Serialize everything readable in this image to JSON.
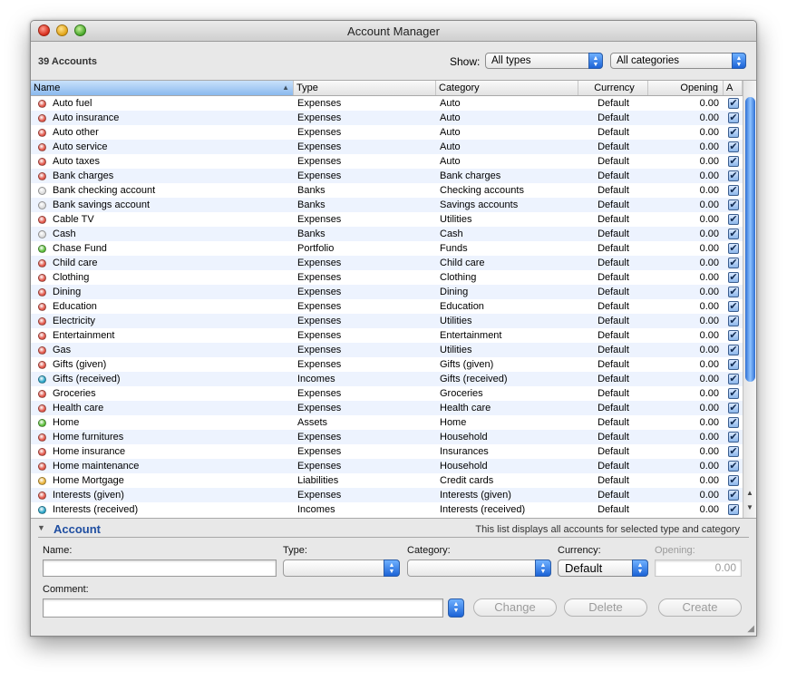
{
  "window": {
    "title": "Account Manager"
  },
  "toolbar": {
    "count_label": "39 Accounts",
    "show_label": "Show:",
    "type_filter": "All types",
    "category_filter": "All categories"
  },
  "table": {
    "columns": [
      "Name",
      "Type",
      "Category",
      "Currency",
      "Opening",
      "A"
    ],
    "sort_indicator": "▲",
    "rows": [
      {
        "name": "Auto fuel",
        "type": "Expenses",
        "category": "Auto",
        "currency": "Default",
        "opening": "0.00",
        "color": "#e2574a",
        "checked": true
      },
      {
        "name": "Auto insurance",
        "type": "Expenses",
        "category": "Auto",
        "currency": "Default",
        "opening": "0.00",
        "color": "#e2574a",
        "checked": true
      },
      {
        "name": "Auto other",
        "type": "Expenses",
        "category": "Auto",
        "currency": "Default",
        "opening": "0.00",
        "color": "#e2574a",
        "checked": true
      },
      {
        "name": "Auto service",
        "type": "Expenses",
        "category": "Auto",
        "currency": "Default",
        "opening": "0.00",
        "color": "#e2574a",
        "checked": true
      },
      {
        "name": "Auto taxes",
        "type": "Expenses",
        "category": "Auto",
        "currency": "Default",
        "opening": "0.00",
        "color": "#e2574a",
        "checked": true
      },
      {
        "name": "Bank charges",
        "type": "Expenses",
        "category": "Bank charges",
        "currency": "Default",
        "opening": "0.00",
        "color": "#e2574a",
        "checked": true
      },
      {
        "name": "Bank checking account",
        "type": "Banks",
        "category": "Checking accounts",
        "currency": "Default",
        "opening": "0.00",
        "color": "#dcdcdc",
        "checked": true
      },
      {
        "name": "Bank savings account",
        "type": "Banks",
        "category": "Savings accounts",
        "currency": "Default",
        "opening": "0.00",
        "color": "#dcdcdc",
        "checked": true
      },
      {
        "name": "Cable TV",
        "type": "Expenses",
        "category": "Utilities",
        "currency": "Default",
        "opening": "0.00",
        "color": "#e2574a",
        "checked": true
      },
      {
        "name": "Cash",
        "type": "Banks",
        "category": "Cash",
        "currency": "Default",
        "opening": "0.00",
        "color": "#dcdcdc",
        "checked": true
      },
      {
        "name": "Chase Fund",
        "type": "Portfolio",
        "category": "Funds",
        "currency": "Default",
        "opening": "0.00",
        "color": "#5cbf3a",
        "checked": true
      },
      {
        "name": "Child care",
        "type": "Expenses",
        "category": "Child care",
        "currency": "Default",
        "opening": "0.00",
        "color": "#e2574a",
        "checked": true
      },
      {
        "name": "Clothing",
        "type": "Expenses",
        "category": "Clothing",
        "currency": "Default",
        "opening": "0.00",
        "color": "#e2574a",
        "checked": true
      },
      {
        "name": "Dining",
        "type": "Expenses",
        "category": "Dining",
        "currency": "Default",
        "opening": "0.00",
        "color": "#e2574a",
        "checked": true
      },
      {
        "name": "Education",
        "type": "Expenses",
        "category": "Education",
        "currency": "Default",
        "opening": "0.00",
        "color": "#e2574a",
        "checked": true
      },
      {
        "name": "Electricity",
        "type": "Expenses",
        "category": "Utilities",
        "currency": "Default",
        "opening": "0.00",
        "color": "#e2574a",
        "checked": true
      },
      {
        "name": "Entertainment",
        "type": "Expenses",
        "category": "Entertainment",
        "currency": "Default",
        "opening": "0.00",
        "color": "#e2574a",
        "checked": true
      },
      {
        "name": "Gas",
        "type": "Expenses",
        "category": "Utilities",
        "currency": "Default",
        "opening": "0.00",
        "color": "#e2574a",
        "checked": true
      },
      {
        "name": "Gifts (given)",
        "type": "Expenses",
        "category": "Gifts (given)",
        "currency": "Default",
        "opening": "0.00",
        "color": "#e2574a",
        "checked": true
      },
      {
        "name": "Gifts (received)",
        "type": "Incomes",
        "category": "Gifts (received)",
        "currency": "Default",
        "opening": "0.00",
        "color": "#2ba6c9",
        "checked": true
      },
      {
        "name": "Groceries",
        "type": "Expenses",
        "category": "Groceries",
        "currency": "Default",
        "opening": "0.00",
        "color": "#e2574a",
        "checked": true
      },
      {
        "name": "Health care",
        "type": "Expenses",
        "category": "Health care",
        "currency": "Default",
        "opening": "0.00",
        "color": "#e2574a",
        "checked": true
      },
      {
        "name": "Home",
        "type": "Assets",
        "category": "Home",
        "currency": "Default",
        "opening": "0.00",
        "color": "#5cbf3a",
        "checked": true
      },
      {
        "name": "Home furnitures",
        "type": "Expenses",
        "category": "Household",
        "currency": "Default",
        "opening": "0.00",
        "color": "#e2574a",
        "checked": true
      },
      {
        "name": "Home insurance",
        "type": "Expenses",
        "category": "Insurances",
        "currency": "Default",
        "opening": "0.00",
        "color": "#e2574a",
        "checked": true
      },
      {
        "name": "Home maintenance",
        "type": "Expenses",
        "category": "Household",
        "currency": "Default",
        "opening": "0.00",
        "color": "#e2574a",
        "checked": true
      },
      {
        "name": "Home Mortgage",
        "type": "Liabilities",
        "category": "Credit cards",
        "currency": "Default",
        "opening": "0.00",
        "color": "#e8b23a",
        "checked": true
      },
      {
        "name": "Interests (given)",
        "type": "Expenses",
        "category": "Interests (given)",
        "currency": "Default",
        "opening": "0.00",
        "color": "#e2574a",
        "checked": true
      },
      {
        "name": "Interests (received)",
        "type": "Incomes",
        "category": "Interests (received)",
        "currency": "Default",
        "opening": "0.00",
        "color": "#2ba6c9",
        "checked": true
      }
    ]
  },
  "account_panel": {
    "title": "Account",
    "hint": "This list displays all accounts for selected type and category",
    "labels": {
      "name": "Name:",
      "type": "Type:",
      "category": "Category:",
      "currency": "Currency:",
      "opening": "Opening:",
      "comment": "Comment:"
    },
    "values": {
      "name": "",
      "type": "",
      "category": "",
      "currency": "Default",
      "opening": "0.00",
      "comment": ""
    },
    "buttons": {
      "change": "Change",
      "delete": "Delete",
      "create": "Create"
    }
  }
}
